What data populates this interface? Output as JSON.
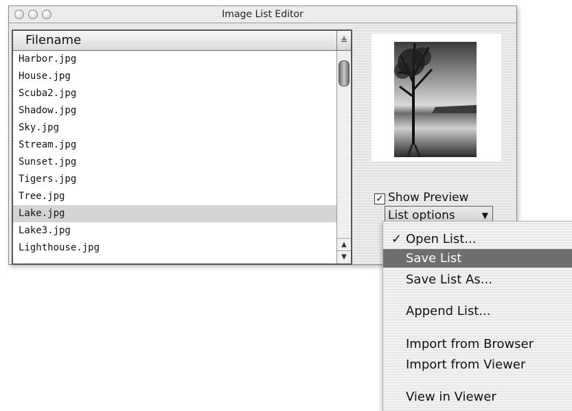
{
  "window": {
    "title": "Image List Editor"
  },
  "list": {
    "header": "Filename",
    "sort_glyph": "≜",
    "rows": [
      "Harbor.jpg",
      "House.jpg",
      "Scuba2.jpg",
      "Shadow.jpg",
      "Sky.jpg",
      "Stream.jpg",
      "Sunset.jpg",
      "Tigers.jpg",
      "Tree.jpg",
      "Lake.jpg",
      "Lake3.jpg",
      "Lighthouse.jpg"
    ],
    "selected_index": 9
  },
  "preview": {
    "show_preview_label": "Show Preview",
    "show_preview_checked": true
  },
  "list_options": {
    "label": "List options",
    "menu": [
      {
        "label": "Open List...",
        "checked": true,
        "highlighted": false
      },
      {
        "label": "Save List",
        "checked": false,
        "highlighted": true
      },
      {
        "label": "Save List As...",
        "checked": false,
        "highlighted": false
      },
      {
        "label": "Append List...",
        "checked": false,
        "highlighted": false
      },
      {
        "label": "Import from Browser",
        "checked": false,
        "highlighted": false
      },
      {
        "label": "Import from Viewer",
        "checked": false,
        "highlighted": false
      },
      {
        "label": "View in Viewer",
        "checked": false,
        "highlighted": false
      }
    ]
  },
  "colors": {
    "selection": "#d4d4d4",
    "menu_highlight": "#6e6e6e"
  }
}
